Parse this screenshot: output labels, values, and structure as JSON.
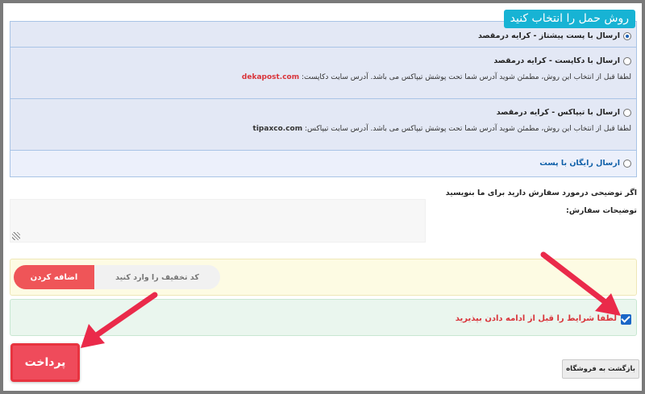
{
  "shipping": {
    "title": "روش حمل را انتخاب کنید",
    "options": [
      {
        "label": "ارسال با پست پیشتاز - کرایه درمقصد",
        "selected": true
      },
      {
        "label": "ارسال با دکاپست - کرایه درمقصد",
        "note": "لطفا قبل از انتخاب این روش، مطمئن شوید آدرس شما تحت پوشش تیپاکس می باشد. آدرس سایت دکاپست:",
        "site": "dekapost.com",
        "selected": false
      },
      {
        "label": "ارسال با تیپاکس - کرایه درمقصد",
        "note": "لطفا قبل از انتخاب این روش، مطمئن شوید آدرس شما تحت پوشش تیپاکس می باشد. آدرس سایت تیپاکس:",
        "site": "tipaxco.com",
        "selected": false
      },
      {
        "label": "ارسال رایگان با پست",
        "selected": false
      }
    ]
  },
  "notes": {
    "heading": "اگر توضیحی درمورد سفارش دارید برای ما بنویسید",
    "label": "توضیحات سفارش:",
    "value": ""
  },
  "coupon": {
    "placeholder": "کد تخفیف را وارد کنید",
    "button_label": "اضافه کردن"
  },
  "terms": {
    "label": "لطفا شرایط را قبل از ادامه دادن بپذیرید",
    "checked": true
  },
  "actions": {
    "pay_label": "پرداخت",
    "back_label": "بازگشت به فروشگاه"
  },
  "colors": {
    "accent": "#17b3d4",
    "danger": "#ef4b5b",
    "arrow": "#ea2a4a"
  }
}
